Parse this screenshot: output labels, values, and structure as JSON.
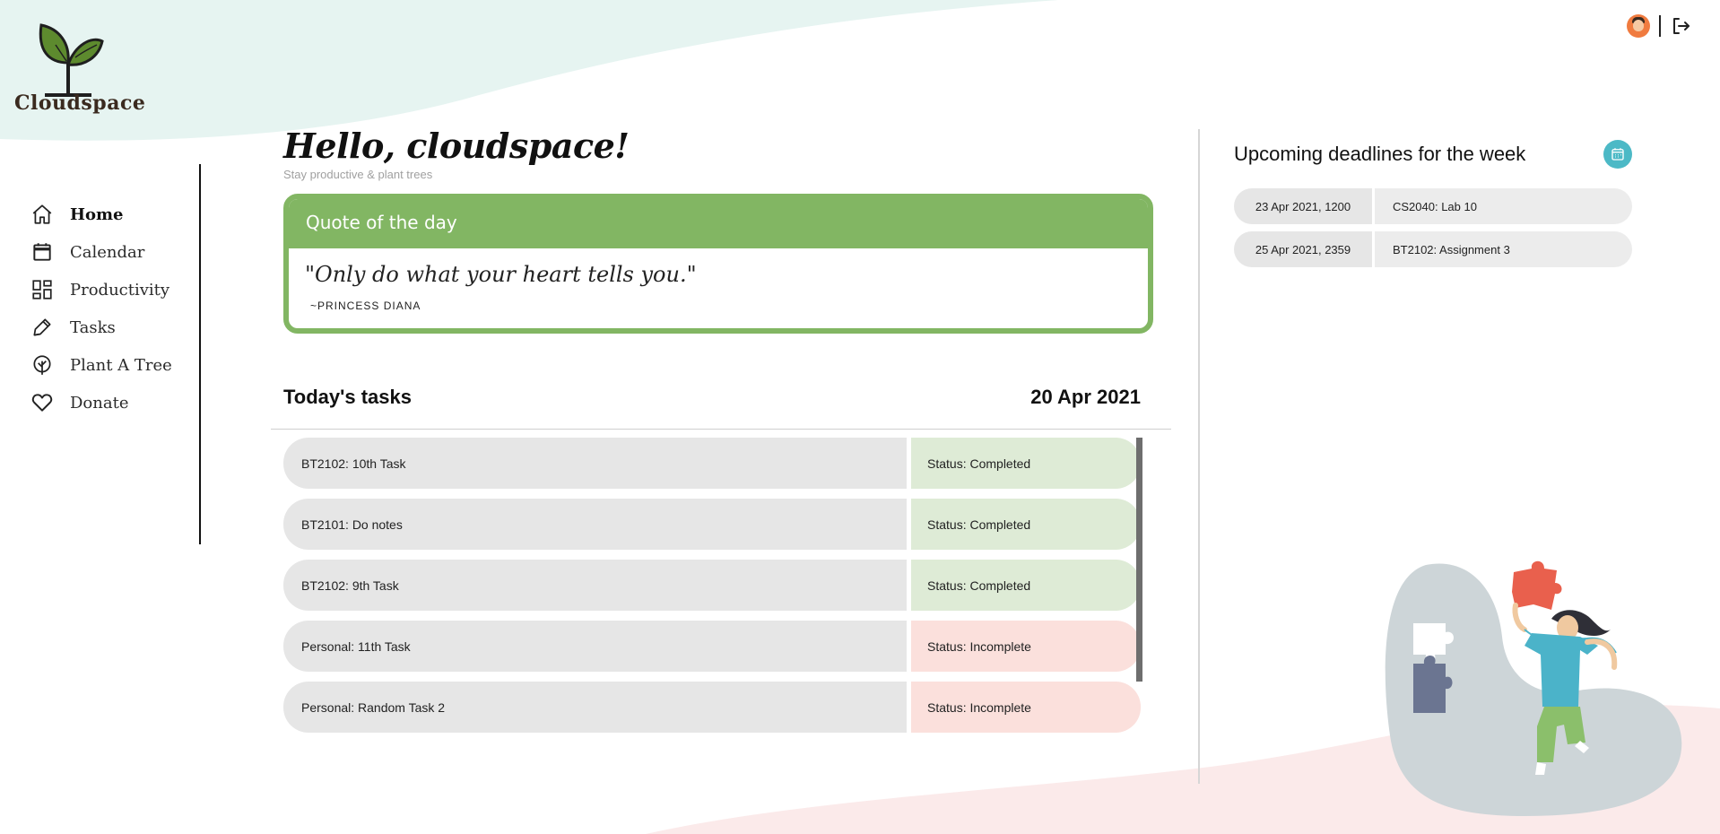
{
  "app": {
    "name": "Cloudspace"
  },
  "topbar": {
    "avatar_icon": "user-avatar-icon",
    "logout_icon": "logout-icon"
  },
  "sidebar": {
    "items": [
      {
        "label": "Home",
        "icon": "home-icon",
        "active": true
      },
      {
        "label": "Calendar",
        "icon": "calendar-icon",
        "active": false
      },
      {
        "label": "Productivity",
        "icon": "dashboard-icon",
        "active": false
      },
      {
        "label": "Tasks",
        "icon": "pen-icon",
        "active": false
      },
      {
        "label": "Plant A Tree",
        "icon": "tree-icon",
        "active": false
      },
      {
        "label": "Donate",
        "icon": "heart-icon",
        "active": false
      }
    ]
  },
  "main": {
    "greeting": "Hello, cloudspace!",
    "subtitle": "Stay productive & plant trees",
    "quote": {
      "heading": "Quote of the day",
      "text": "\"Only do what your heart tells you.\"",
      "author": "~PRINCESS DIANA"
    },
    "tasks": {
      "title": "Today's tasks",
      "date": "20 Apr 2021",
      "rows": [
        {
          "name": "BT2102: 10th Task",
          "status": "Status: Completed"
        },
        {
          "name": "BT2101: Do notes",
          "status": "Status: Completed"
        },
        {
          "name": "BT2102: 9th Task",
          "status": "Status: Completed"
        },
        {
          "name": "Personal: 11th Task",
          "status": "Status: Incomplete"
        },
        {
          "name": "Personal: Random Task 2",
          "status": "Status: Incomplete"
        }
      ]
    }
  },
  "deadlines": {
    "title": "Upcoming deadlines for the week",
    "icon": "calendar-icon",
    "rows": [
      {
        "date": "23 Apr 2021, 1200",
        "name": "CS2040: Lab 10"
      },
      {
        "date": "25 Apr 2021, 2359",
        "name": "BT2102: Assignment 3"
      }
    ]
  },
  "colors": {
    "accent_green": "#82b663",
    "completed_bg": "#deebd6",
    "incomplete_bg": "#fbe0dc",
    "calendar_badge": "#4cb9c6",
    "top_wave": "#e6f4f1",
    "bottom_wave": "#fbeaea"
  }
}
